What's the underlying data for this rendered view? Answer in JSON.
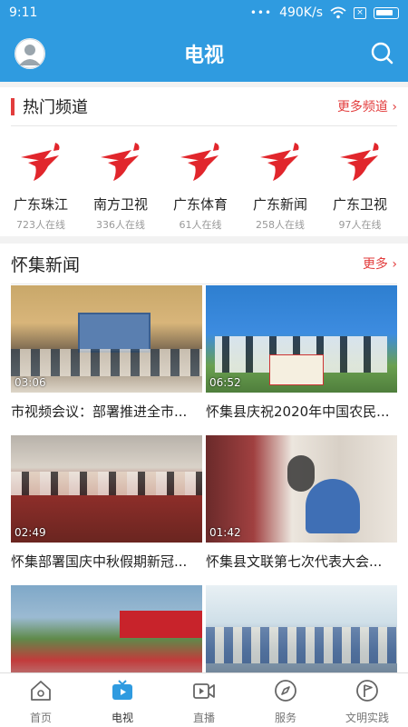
{
  "status": {
    "time": "9:11",
    "speed": "490K/s"
  },
  "header": {
    "title": "电视"
  },
  "hot": {
    "title": "热门频道",
    "more": "更多频道",
    "channels": [
      {
        "name": "广东珠江",
        "viewers": "723人在线"
      },
      {
        "name": "南方卫视",
        "viewers": "336人在线"
      },
      {
        "name": "广东体育",
        "viewers": "61人在线"
      },
      {
        "name": "广东新闻",
        "viewers": "258人在线"
      },
      {
        "name": "广东卫视",
        "viewers": "97人在线"
      }
    ]
  },
  "news": {
    "title": "怀集新闻",
    "more": "更多",
    "items": [
      {
        "duration": "03:06",
        "title": "市视频会议：部署推进全市..."
      },
      {
        "duration": "06:52",
        "title": "怀集县庆祝2020年中国农民..."
      },
      {
        "duration": "02:49",
        "title": "怀集部署国庆中秋假期新冠..."
      },
      {
        "duration": "01:42",
        "title": "怀集县文联第七次代表大会..."
      },
      {
        "duration": "",
        "title": ""
      },
      {
        "duration": "",
        "title": ""
      }
    ]
  },
  "tabs": [
    {
      "label": "首页",
      "icon": "home-icon"
    },
    {
      "label": "电视",
      "icon": "tv-icon"
    },
    {
      "label": "直播",
      "icon": "live-video-icon"
    },
    {
      "label": "服务",
      "icon": "compass-icon"
    },
    {
      "label": "文明实践",
      "icon": "flag-icon"
    }
  ],
  "colors": {
    "primary": "#2f9be0",
    "accent": "#e23d3d"
  }
}
